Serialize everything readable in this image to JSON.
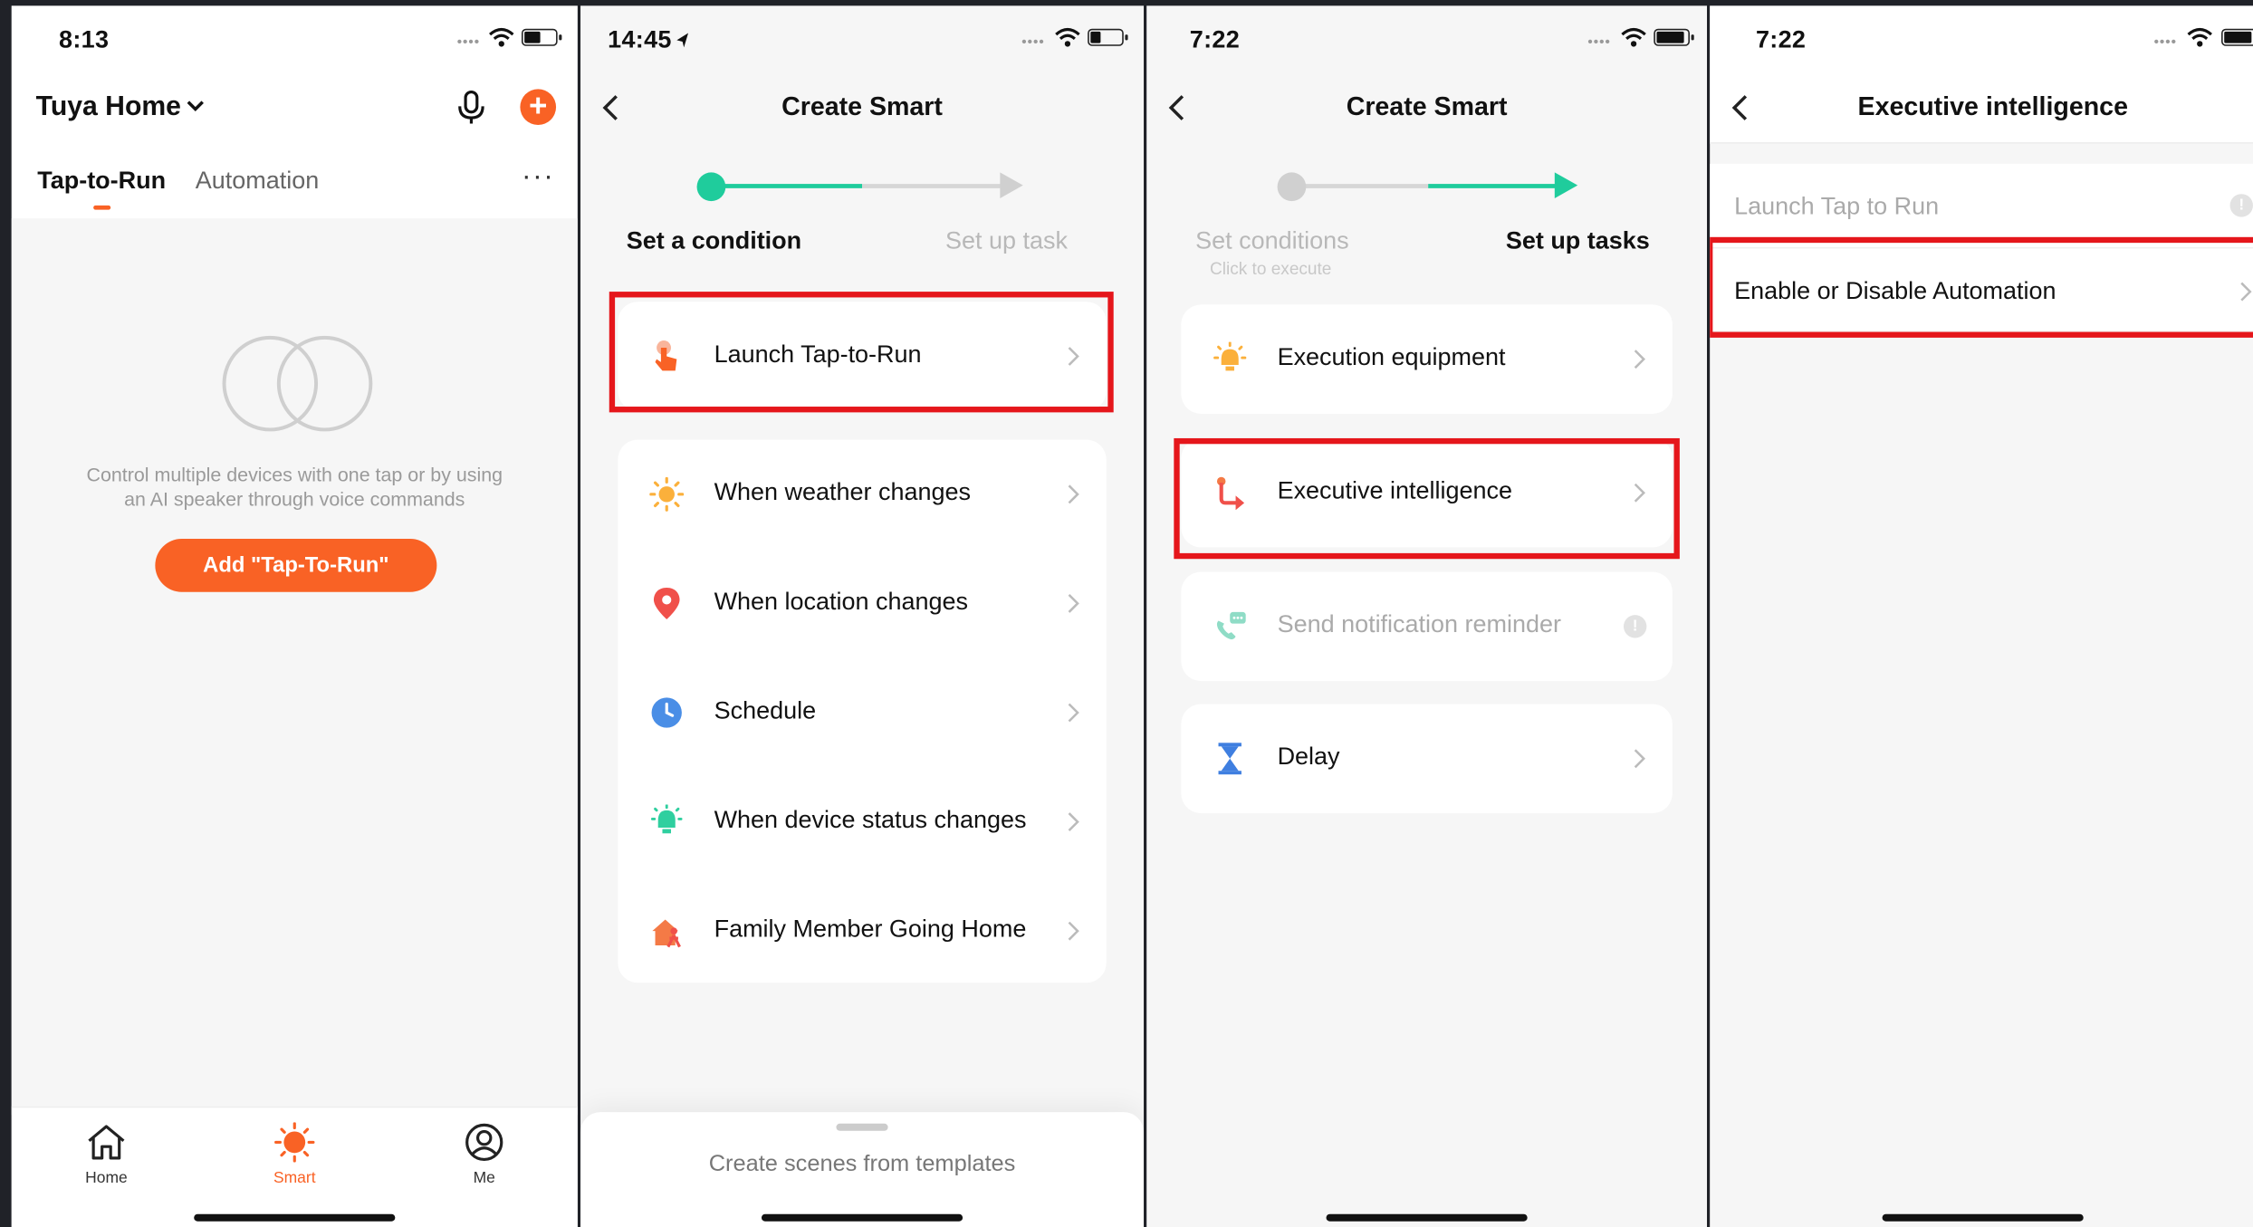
{
  "colors": {
    "accent": "#f96225",
    "teal": "#1fcc9c",
    "highlight": "#e5161b"
  },
  "panel1": {
    "time": "8:13",
    "home_title": "Tuya Home",
    "tabs": [
      "Tap-to-Run",
      "Automation"
    ],
    "more": "···",
    "empty_text_1": "Control multiple devices with one tap or by using",
    "empty_text_2": "an AI speaker through voice commands",
    "add_button": "Add \"Tap-To-Run\"",
    "tabbar": [
      {
        "label": "Home",
        "icon": "home-icon"
      },
      {
        "label": "Smart",
        "icon": "smart-icon"
      },
      {
        "label": "Me",
        "icon": "profile-icon"
      }
    ]
  },
  "panel2": {
    "time": "14:45",
    "title": "Create Smart",
    "steps": [
      "Set a condition",
      "Set up task"
    ],
    "highlight_item": {
      "label": "Launch Tap-to-Run",
      "icon": "tap-hand-icon"
    },
    "items": [
      {
        "label": "When weather changes",
        "icon": "sun-icon"
      },
      {
        "label": "When location changes",
        "icon": "location-pin-icon"
      },
      {
        "label": "Schedule",
        "icon": "clock-icon"
      },
      {
        "label": "When device status changes",
        "icon": "device-icon"
      },
      {
        "label": "Family Member Going Home",
        "icon": "home-person-icon"
      }
    ],
    "sheet_text": "Create scenes from templates"
  },
  "panel3": {
    "time": "7:22",
    "title": "Create Smart",
    "steps": [
      "Set conditions",
      "Set up tasks"
    ],
    "step_sub": "Click to execute",
    "items": [
      {
        "label": "Execution equipment",
        "icon": "bulb-icon"
      },
      {
        "label": "Executive intelligence",
        "icon": "branch-arrow-icon"
      },
      {
        "label": "Send notification reminder",
        "icon": "phone-message-icon"
      },
      {
        "label": "Delay",
        "icon": "hourglass-icon"
      }
    ]
  },
  "panel4": {
    "time": "7:22",
    "title": "Executive intelligence",
    "items": [
      "Launch Tap to Run",
      "Enable or Disable Automation"
    ]
  }
}
